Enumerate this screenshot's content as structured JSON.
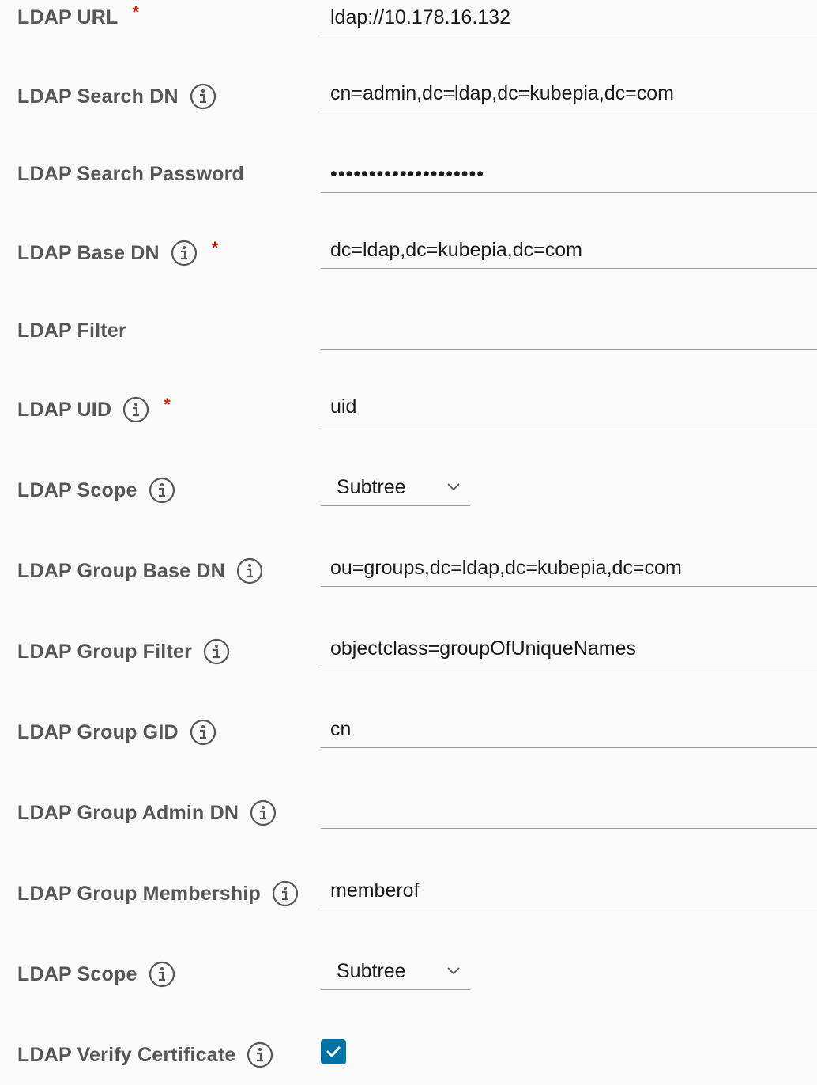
{
  "fields": [
    {
      "label": "LDAP URL",
      "info": false,
      "required": true,
      "type": "text",
      "value": "ldap://10.178.16.132"
    },
    {
      "label": "LDAP Search DN",
      "info": true,
      "required": false,
      "type": "text",
      "value": "cn=admin,dc=ldap,dc=kubepia,dc=com"
    },
    {
      "label": "LDAP Search Password",
      "info": false,
      "required": false,
      "type": "password",
      "value": "••••••••••••••••••••"
    },
    {
      "label": "LDAP Base DN",
      "info": true,
      "required": true,
      "type": "text",
      "value": "dc=ldap,dc=kubepia,dc=com"
    },
    {
      "label": "LDAP Filter",
      "info": false,
      "required": false,
      "type": "text",
      "value": ""
    },
    {
      "label": "LDAP UID",
      "info": true,
      "required": true,
      "type": "text",
      "value": "uid"
    },
    {
      "label": "LDAP Scope",
      "info": true,
      "required": false,
      "type": "select",
      "value": "Subtree"
    },
    {
      "label": "LDAP Group Base DN",
      "info": true,
      "required": false,
      "type": "text",
      "value": "ou=groups,dc=ldap,dc=kubepia,dc=com"
    },
    {
      "label": "LDAP Group Filter",
      "info": true,
      "required": false,
      "type": "text",
      "value": "objectclass=groupOfUniqueNames"
    },
    {
      "label": "LDAP Group GID",
      "info": true,
      "required": false,
      "type": "text",
      "value": "cn"
    },
    {
      "label": "LDAP Group Admin DN",
      "info": true,
      "required": false,
      "type": "text",
      "value": ""
    },
    {
      "label": "LDAP Group Membership",
      "info": true,
      "required": false,
      "type": "text",
      "value": "memberof"
    },
    {
      "label": "LDAP Scope",
      "info": true,
      "required": false,
      "type": "select",
      "value": "Subtree"
    },
    {
      "label": "LDAP Verify Certificate",
      "info": true,
      "required": false,
      "type": "checkbox",
      "value": "checked"
    }
  ],
  "required_mark": "*",
  "colors": {
    "label": "#565656",
    "required": "#c92100",
    "checkbox": "#0072a3",
    "underline": "#9a9a9a"
  }
}
